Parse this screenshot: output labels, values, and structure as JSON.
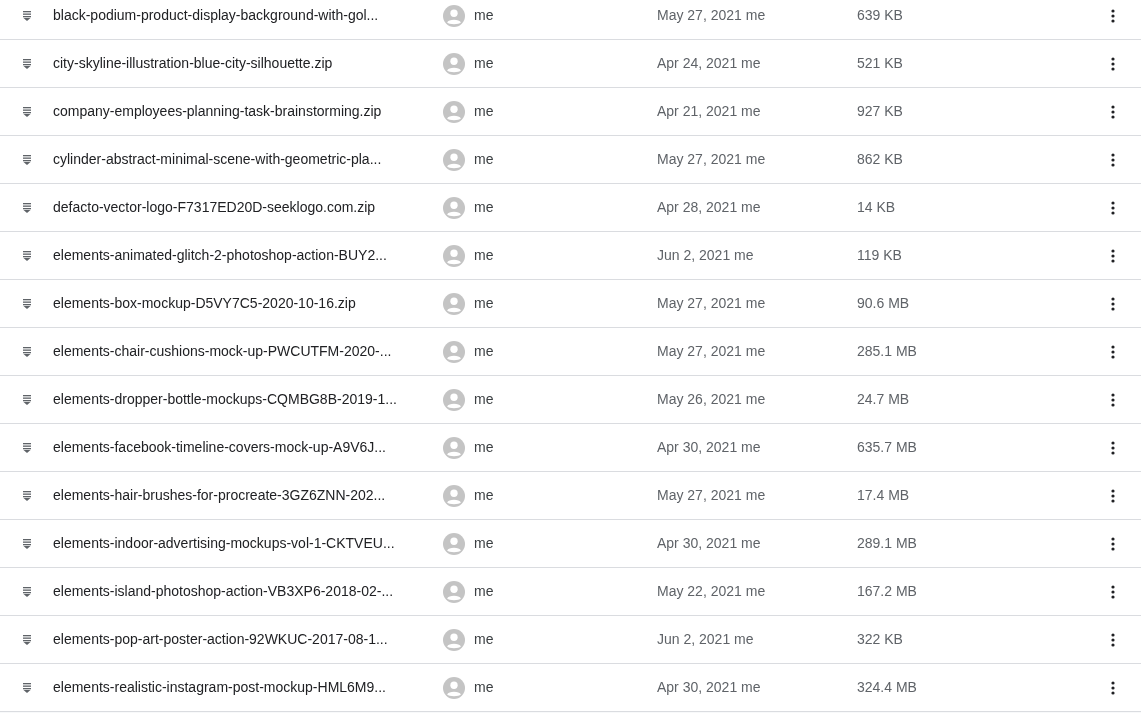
{
  "files": [
    {
      "name": "black-podium-product-display-background-with-gol...",
      "owner": "me",
      "modified": "May 27, 2021 me",
      "size": "639 KB"
    },
    {
      "name": "city-skyline-illustration-blue-city-silhouette.zip",
      "owner": "me",
      "modified": "Apr 24, 2021 me",
      "size": "521 KB"
    },
    {
      "name": "company-employees-planning-task-brainstorming.zip",
      "owner": "me",
      "modified": "Apr 21, 2021 me",
      "size": "927 KB"
    },
    {
      "name": "cylinder-abstract-minimal-scene-with-geometric-pla...",
      "owner": "me",
      "modified": "May 27, 2021 me",
      "size": "862 KB"
    },
    {
      "name": "defacto-vector-logo-F7317ED20D-seeklogo.com.zip",
      "owner": "me",
      "modified": "Apr 28, 2021 me",
      "size": "14 KB"
    },
    {
      "name": "elements-animated-glitch-2-photoshop-action-BUY2...",
      "owner": "me",
      "modified": "Jun 2, 2021 me",
      "size": "119 KB"
    },
    {
      "name": "elements-box-mockup-D5VY7C5-2020-10-16.zip",
      "owner": "me",
      "modified": "May 27, 2021 me",
      "size": "90.6 MB"
    },
    {
      "name": "elements-chair-cushions-mock-up-PWCUTFM-2020-...",
      "owner": "me",
      "modified": "May 27, 2021 me",
      "size": "285.1 MB"
    },
    {
      "name": "elements-dropper-bottle-mockups-CQMBG8B-2019-1...",
      "owner": "me",
      "modified": "May 26, 2021 me",
      "size": "24.7 MB"
    },
    {
      "name": "elements-facebook-timeline-covers-mock-up-A9V6J...",
      "owner": "me",
      "modified": "Apr 30, 2021 me",
      "size": "635.7 MB"
    },
    {
      "name": "elements-hair-brushes-for-procreate-3GZ6ZNN-202...",
      "owner": "me",
      "modified": "May 27, 2021 me",
      "size": "17.4 MB"
    },
    {
      "name": "elements-indoor-advertising-mockups-vol-1-CKTVEU...",
      "owner": "me",
      "modified": "Apr 30, 2021 me",
      "size": "289.1 MB"
    },
    {
      "name": "elements-island-photoshop-action-VB3XP6-2018-02-...",
      "owner": "me",
      "modified": "May 22, 2021 me",
      "size": "167.2 MB"
    },
    {
      "name": "elements-pop-art-poster-action-92WKUC-2017-08-1...",
      "owner": "me",
      "modified": "Jun 2, 2021 me",
      "size": "322 KB"
    },
    {
      "name": "elements-realistic-instagram-post-mockup-HML6M9...",
      "owner": "me",
      "modified": "Apr 30, 2021 me",
      "size": "324.4 MB"
    }
  ]
}
